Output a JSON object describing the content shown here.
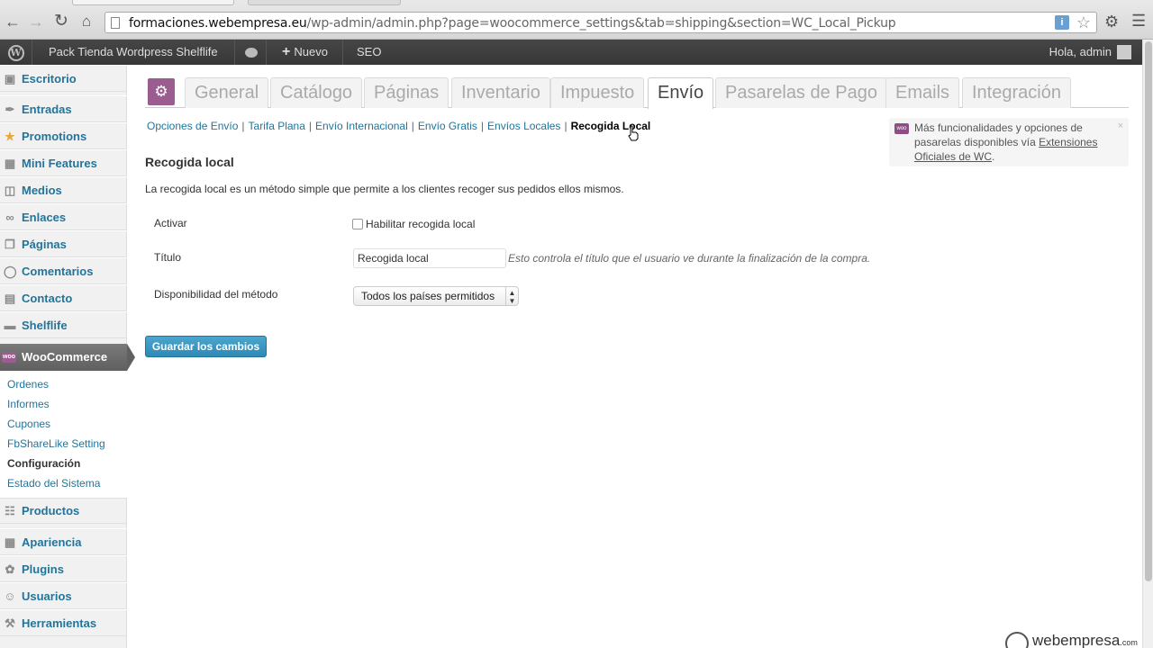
{
  "browser": {
    "url_host": "formaciones.webempresa.eu",
    "url_path": "/wp-admin/admin.php?page=woocommerce_settings&tab=shipping&section=WC_Local_Pickup"
  },
  "adminbar": {
    "site_name": "Pack Tienda Wordpress Shelflife",
    "new_label": "Nuevo",
    "seo_label": "SEO",
    "account_label": "Hola, admin"
  },
  "sidebar": {
    "items": [
      {
        "label": "Escritorio",
        "icon": "dashboard-icon"
      },
      {
        "label": "Entradas",
        "icon": "pin-icon"
      },
      {
        "label": "Promotions",
        "icon": "star-icon"
      },
      {
        "label": "Mini Features",
        "icon": "features-icon"
      },
      {
        "label": "Medios",
        "icon": "media-icon"
      },
      {
        "label": "Enlaces",
        "icon": "link-icon"
      },
      {
        "label": "Páginas",
        "icon": "pages-icon"
      },
      {
        "label": "Comentarios",
        "icon": "comments-icon"
      },
      {
        "label": "Contacto",
        "icon": "contact-icon"
      },
      {
        "label": "Shelflife",
        "icon": "shelflife-icon"
      },
      {
        "label": "WooCommerce",
        "icon": "woocommerce-icon"
      },
      {
        "label": "Productos",
        "icon": "products-icon"
      },
      {
        "label": "Apariencia",
        "icon": "appearance-icon"
      },
      {
        "label": "Plugins",
        "icon": "plugins-icon"
      },
      {
        "label": "Usuarios",
        "icon": "users-icon"
      },
      {
        "label": "Herramientas",
        "icon": "tools-icon"
      }
    ],
    "submenu": [
      "Ordenes",
      "Informes",
      "Cupones",
      "FbShareLike Setting",
      "Configuración",
      "Estado del Sistema"
    ]
  },
  "tabs": [
    "General",
    "Catálogo",
    "Páginas",
    "Inventario",
    "Impuesto",
    "Envío",
    "Pasarelas de Pago",
    "Emails",
    "Integración"
  ],
  "subnav": [
    "Opciones de Envío",
    "Tarifa Plana",
    "Envío Internacional",
    "Envío Gratis",
    "Envíos Locales",
    "Recogida Local"
  ],
  "notice": {
    "text": "Más funcionalidades y opciones de pasarelas disponibles vía ",
    "link": "Extensiones Oficiales de WC",
    "end": ".",
    "close": "×"
  },
  "section": {
    "title": "Recogida local",
    "description": "La recogida local es un método simple que permite a los clientes recoger sus pedidos ellos mismos."
  },
  "form": {
    "enable_label": "Activar",
    "enable_checkbox_label": "Habilitar recogida local",
    "title_label": "Título",
    "title_value": "Recogida local",
    "title_description": "Esto controla el título que el usuario ve durante la finalización de la compra.",
    "availability_label": "Disponibilidad del método",
    "availability_value": "Todos los países permitidos"
  },
  "save_label": "Guardar los cambios",
  "watermark": {
    "name": "webempresa",
    "suffix": ".com"
  },
  "colors": {
    "accent": "#21759b",
    "woo": "#9b5c8f"
  }
}
